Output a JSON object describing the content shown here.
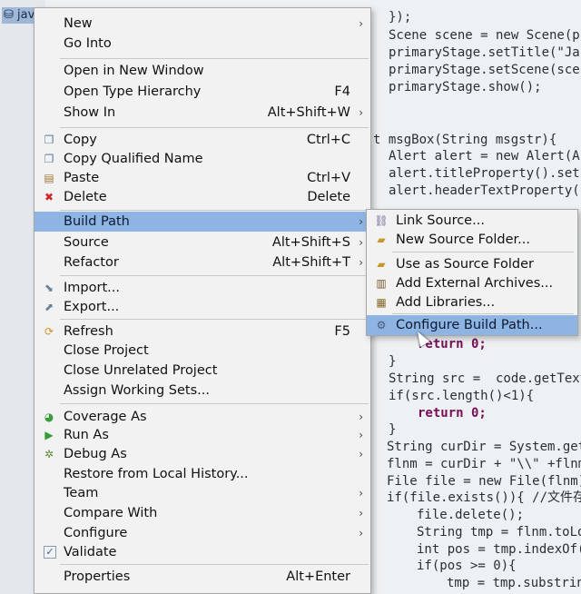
{
  "project_explorer": {
    "selected_item": "java"
  },
  "editor": {
    "lines": [
      "});",
      "Scene scene = new Scene(p",
      "primaryStage.setTitle(\"Ja",
      "primaryStage.setScene(sce",
      "primaryStage.show();",
      "t msgBox(String msgstr){",
      "Alert alert = new Alert(A",
      "alert.titleProperty().set",
      "alert.headerTextProperty(",
      "return 0;",
      "}",
      "String src =  code.getText",
      "if(src.length()<1){",
      "return 0;",
      "}",
      "String curDir = System.get",
      "flnm = curDir + \"\\\\\" +flnm",
      "File file = new File(flnm)",
      "if(file.exists()){ //文件存",
      "file.delete();",
      "String tmp = flnm.toLo",
      "int pos = tmp.indexOf(",
      "if(pos >= 0){",
      "tmp = tmp.substrin"
    ]
  },
  "context_menu": {
    "items": [
      {
        "label": "New",
        "shortcut": "",
        "submenu": true
      },
      {
        "label": "Go Into",
        "shortcut": "",
        "submenu": false
      },
      {
        "label": "Open in New Window",
        "shortcut": "",
        "submenu": false
      },
      {
        "label": "Open Type Hierarchy",
        "shortcut": "F4",
        "submenu": false
      },
      {
        "label": "Show In",
        "shortcut": "Alt+Shift+W",
        "submenu": true
      },
      {
        "label": "Copy",
        "shortcut": "Ctrl+C",
        "submenu": false
      },
      {
        "label": "Copy Qualified Name",
        "shortcut": "",
        "submenu": false
      },
      {
        "label": "Paste",
        "shortcut": "Ctrl+V",
        "submenu": false
      },
      {
        "label": "Delete",
        "shortcut": "Delete",
        "submenu": false
      },
      {
        "label": "Build Path",
        "shortcut": "",
        "submenu": true
      },
      {
        "label": "Source",
        "shortcut": "Alt+Shift+S",
        "submenu": true
      },
      {
        "label": "Refactor",
        "shortcut": "Alt+Shift+T",
        "submenu": true
      },
      {
        "label": "Import...",
        "shortcut": "",
        "submenu": false
      },
      {
        "label": "Export...",
        "shortcut": "",
        "submenu": false
      },
      {
        "label": "Refresh",
        "shortcut": "F5",
        "submenu": false
      },
      {
        "label": "Close Project",
        "shortcut": "",
        "submenu": false
      },
      {
        "label": "Close Unrelated Project",
        "shortcut": "",
        "submenu": false
      },
      {
        "label": "Assign Working Sets...",
        "shortcut": "",
        "submenu": false
      },
      {
        "label": "Coverage As",
        "shortcut": "",
        "submenu": true
      },
      {
        "label": "Run As",
        "shortcut": "",
        "submenu": true
      },
      {
        "label": "Debug As",
        "shortcut": "",
        "submenu": true
      },
      {
        "label": "Restore from Local History...",
        "shortcut": "",
        "submenu": false
      },
      {
        "label": "Team",
        "shortcut": "",
        "submenu": true
      },
      {
        "label": "Compare With",
        "shortcut": "",
        "submenu": true
      },
      {
        "label": "Configure",
        "shortcut": "",
        "submenu": true
      },
      {
        "label": "Validate",
        "shortcut": "",
        "submenu": false
      },
      {
        "label": "Properties",
        "shortcut": "Alt+Enter",
        "submenu": false
      }
    ],
    "arrow": "›"
  },
  "build_path_submenu": {
    "items": [
      {
        "label": "Link Source..."
      },
      {
        "label": "New Source Folder..."
      },
      {
        "label": "Use as Source Folder"
      },
      {
        "label": "Add External Archives..."
      },
      {
        "label": "Add Libraries..."
      },
      {
        "label": "Configure Build Path..."
      }
    ]
  },
  "colors": {
    "highlight": "#8db4e2",
    "menu_bg": "#f2f2f2",
    "keyword": "#7a0d55"
  }
}
